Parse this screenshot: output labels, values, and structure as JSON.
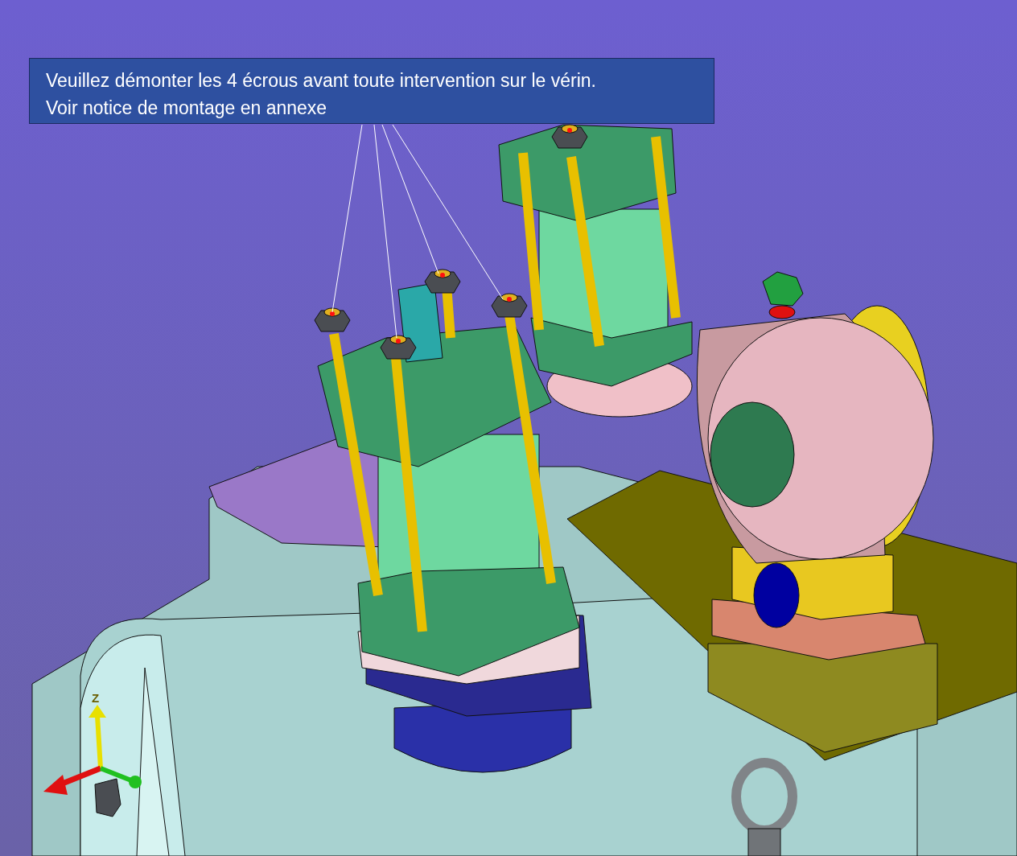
{
  "annotation": {
    "lines": [
      "Veuillez démonter les 4 écrous avant toute intervention sur le vérin.",
      "Voir notice de montage en annexe"
    ]
  },
  "axis_triad": {
    "label": "Z"
  }
}
